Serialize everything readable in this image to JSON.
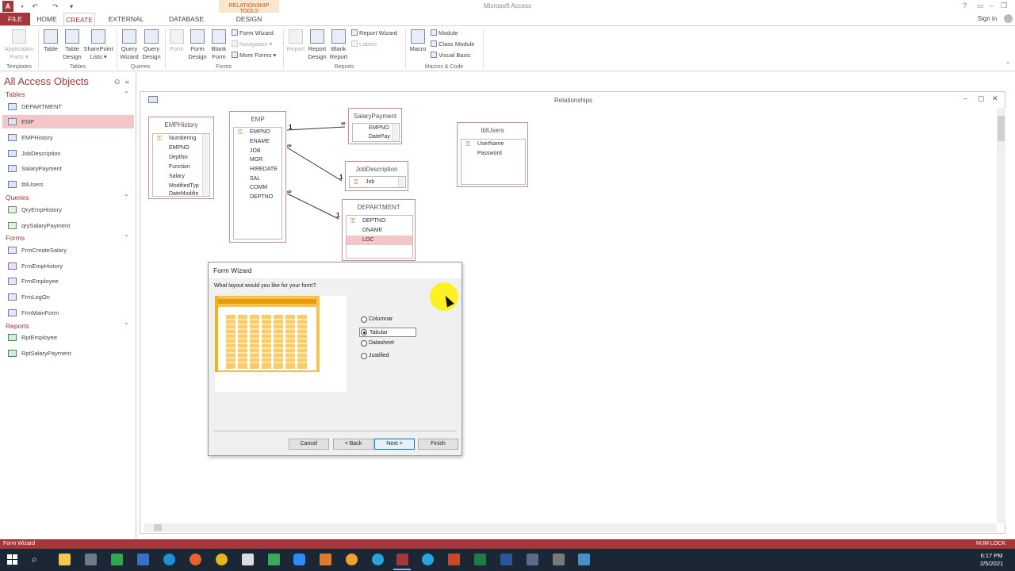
{
  "app_title": "Microsoft Access",
  "contextual_tab_group": "RELATIONSHIP TOOLS",
  "sign_in": "Sign in",
  "tabs": {
    "file": "FILE",
    "home": "HOME",
    "create": "CREATE",
    "external_data": "EXTERNAL DATA",
    "database_tools": "DATABASE TOOLS",
    "design": "DESIGN"
  },
  "ribbon": {
    "application_parts": [
      "Application",
      "Parts ▾"
    ],
    "table": "Table",
    "table_design": [
      "Table",
      "Design"
    ],
    "sharepoint_lists": [
      "SharePoint",
      "Lists ▾"
    ],
    "query_wizard": [
      "Query",
      "Wizard"
    ],
    "query_design": [
      "Query",
      "Design"
    ],
    "form": "Form",
    "form_design": [
      "Form",
      "Design"
    ],
    "blank_form": [
      "Blank",
      "Form"
    ],
    "form_wizard": "Form Wizard",
    "navigation": "Navigation ▾",
    "more_forms": "More Forms ▾",
    "report": "Report",
    "report_design": [
      "Report",
      "Design"
    ],
    "blank_report": [
      "Blank",
      "Report"
    ],
    "report_wizard": "Report Wizard",
    "labels": "Labels",
    "macro": "Macro",
    "module": "Module",
    "class_module": "Class Module",
    "visual_basic": "Visual Basic",
    "groups": {
      "templates": "Templates",
      "tables": "Tables",
      "queries": "Queries",
      "forms": "Forms",
      "reports": "Reports",
      "macros_code": "Macros & Code"
    }
  },
  "nav": {
    "title": "All Access Objects",
    "sections": {
      "tables": "Tables",
      "queries": "Queries",
      "forms": "Forms",
      "reports": "Reports"
    },
    "tables": [
      "DEPARTMENT",
      "EMP",
      "EMPHistory",
      "JobDescription",
      "SalaryPayment",
      "tblUsers"
    ],
    "queries": [
      "QryEmpHistory",
      "qrySalaryPayment"
    ],
    "forms": [
      "FrmCreateSalary",
      "FrmEmpHistory",
      "FrmEmployee",
      "FrmLogOn",
      "FrmMainForm"
    ],
    "reports": [
      "RptEmployee",
      "RptSalaryPayment"
    ]
  },
  "doc_title": "Relationships",
  "rel_tables": {
    "emphistory": {
      "title": "EMPHistory",
      "fields": [
        "Numbering",
        "EMPNO",
        "DeptNo",
        "Function",
        "Salary",
        "ModifiedTyp",
        "DateModifie"
      ]
    },
    "emp": {
      "title": "EMP",
      "fields": [
        "EMPNO",
        "ENAME",
        "JOB",
        "MGR",
        "HIREDATE",
        "SAL",
        "COMM",
        "DEPTNO"
      ]
    },
    "salarypayment": {
      "title": "SalaryPayment",
      "fields": [
        "EMPNO",
        "DatePay"
      ]
    },
    "jobdescription": {
      "title": "JobDescription",
      "fields": [
        "Job"
      ]
    },
    "department": {
      "title": "DEPARTMENT",
      "fields": [
        "DEPTNO",
        "DNAME",
        "LOC"
      ]
    },
    "tblusers": {
      "title": "tblUsers",
      "fields": [
        "UserName",
        "Password"
      ]
    }
  },
  "rel_labels": {
    "one": "1",
    "many": "∞"
  },
  "wizard": {
    "title": "Form Wizard",
    "prompt": "What layout would you like for your form?",
    "options": [
      "Columnar",
      "Tabular",
      "Datasheet",
      "Justified"
    ],
    "selected_option": "Tabular",
    "buttons": {
      "cancel": "Cancel",
      "back": "< Back",
      "next": "Next >",
      "finish": "Finish"
    }
  },
  "status": {
    "left": "Form Wizard",
    "right": "NUM LOCK"
  },
  "taskbar": {
    "time": "6:17 PM",
    "date": "2/5/2021"
  },
  "colors": {
    "access_accent": "#a4373a",
    "selection": "#f4c6c8",
    "preview_orange": "#f6b01e"
  }
}
